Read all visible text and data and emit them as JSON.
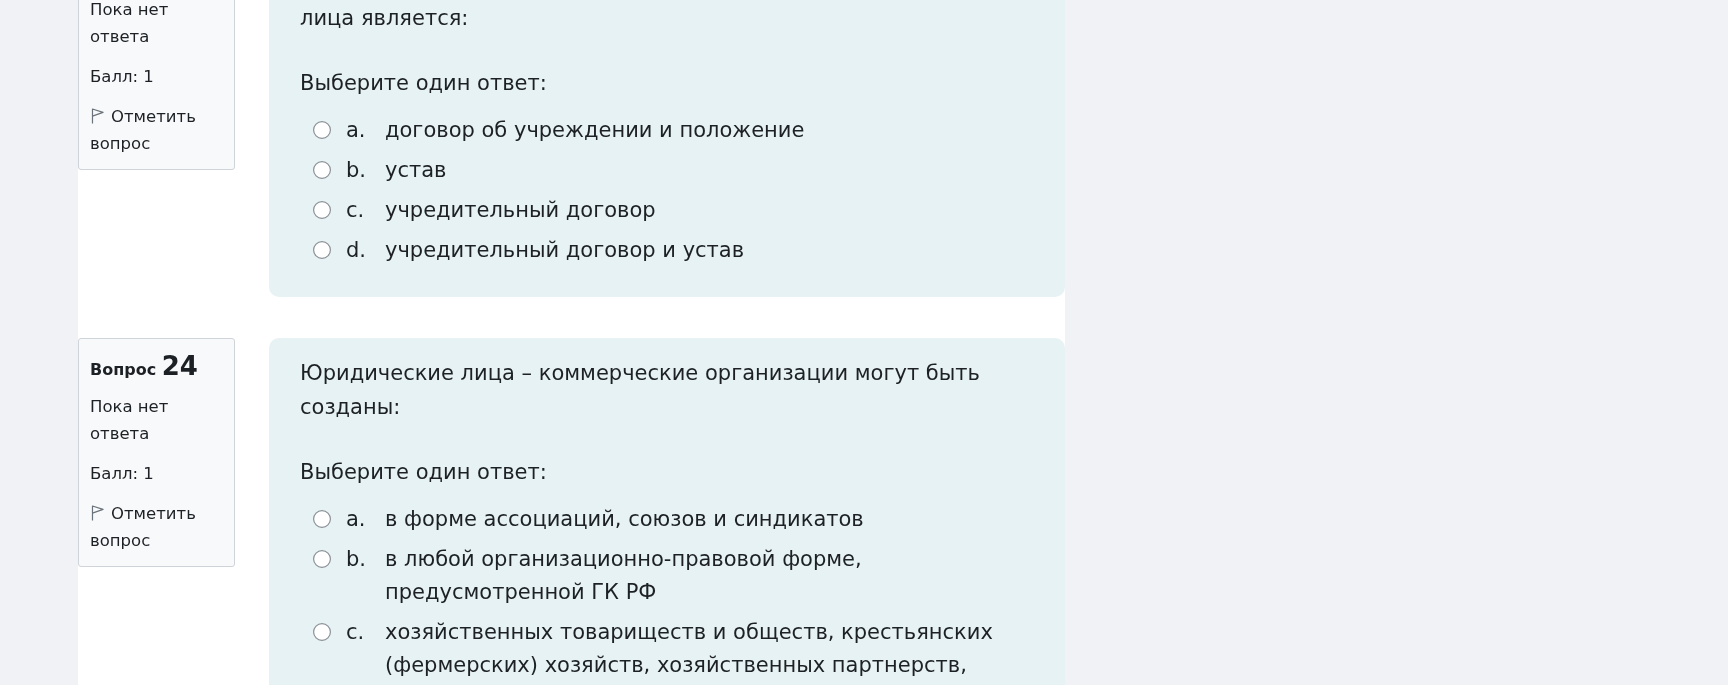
{
  "questions": [
    {
      "info": {
        "status": "Пока нет ответа",
        "grade": "Балл: 1",
        "flag_label": "Отметить вопрос"
      },
      "text": "лица является:",
      "prompt": "Выберите один ответ:",
      "options": [
        {
          "letter": "a.",
          "text": "договор об учреждении и положение",
          "selected": false
        },
        {
          "letter": "b.",
          "text": "устав",
          "selected": false
        },
        {
          "letter": "c.",
          "text": "учредительный договор",
          "selected": false
        },
        {
          "letter": "d.",
          "text": "учредительный договор и устав",
          "selected": false
        }
      ]
    },
    {
      "info": {
        "heading": {
          "label": "Вопрос",
          "number": "24"
        },
        "status": "Пока нет ответа",
        "grade": "Балл: 1",
        "flag_label": "Отметить вопрос"
      },
      "text": "Юридические лица – коммерческие организации могут быть созданы:",
      "prompt": "Выберите один ответ:",
      "options": [
        {
          "letter": "a.",
          "text": "в форме ассоциаций, союзов и синдикатов",
          "selected": false
        },
        {
          "letter": "b.",
          "text": "в любой организационно-правовой форме, предусмотренной ГК РФ",
          "selected": false
        },
        {
          "letter": "c.",
          "text": "хозяйственных товариществ и обществ, крестьянских (фермерских) хозяйств, хозяйственных партнерств,",
          "selected": false
        }
      ]
    }
  ]
}
